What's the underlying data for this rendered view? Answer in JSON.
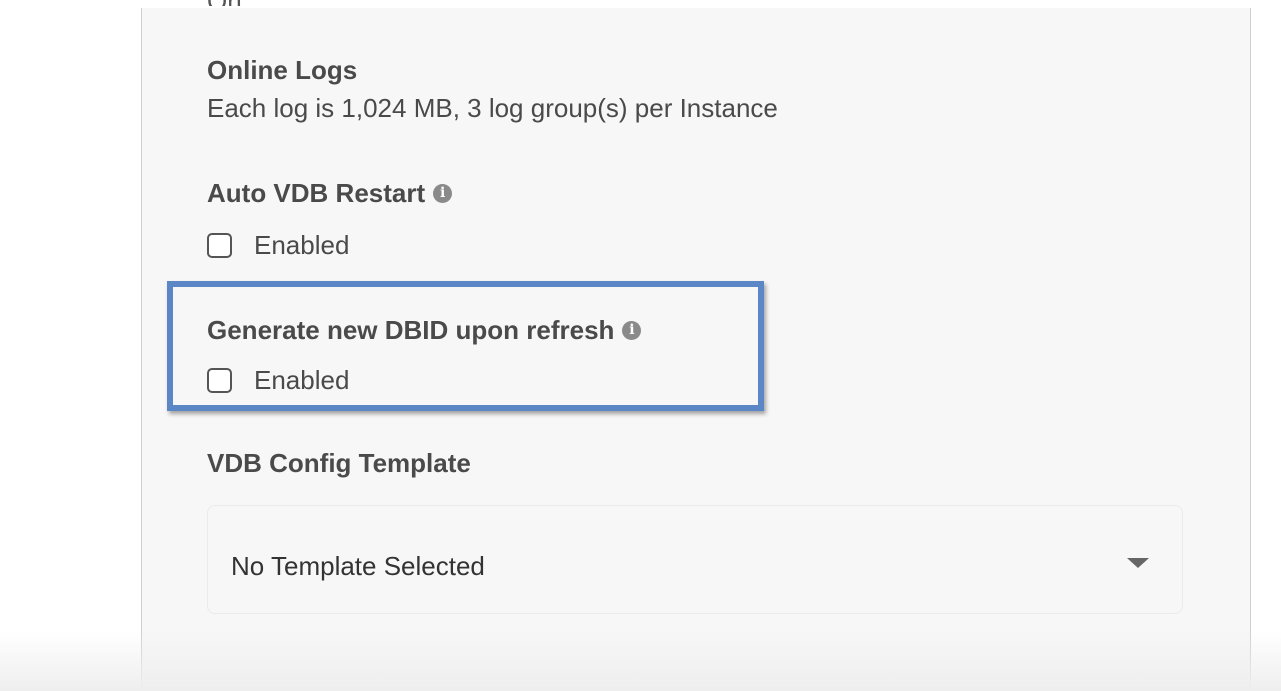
{
  "settings": {
    "cutoff_value": "On",
    "online_logs": {
      "title": "Online Logs",
      "description": "Each log is 1,024 MB, 3 log group(s) per Instance"
    },
    "auto_vdb_restart": {
      "title": "Auto VDB Restart",
      "checkbox_label": "Enabled",
      "checked": false
    },
    "generate_new_dbid": {
      "title": "Generate new DBID upon refresh",
      "checkbox_label": "Enabled",
      "checked": false
    },
    "vdb_config_template": {
      "title": "VDB Config Template",
      "selected": "No Template Selected"
    }
  },
  "icons": {
    "info": "info-circle-icon",
    "dropdown": "caret-down-icon"
  },
  "colors": {
    "highlight": "#5b87c7",
    "panel_background": "#f7f7f7",
    "text": "#4a4a4a"
  }
}
